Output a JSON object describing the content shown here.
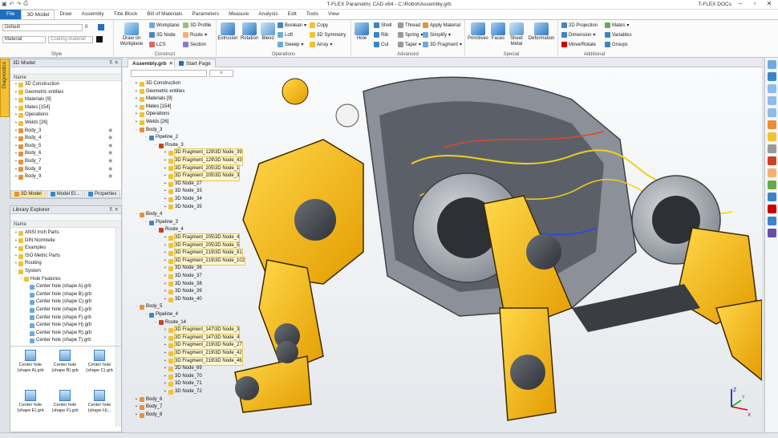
{
  "app": {
    "title": "T-FLEX Parametric CAD x64 - C:\\Robot\\Assembly.grb",
    "docs": "T-FLEX DOCs"
  },
  "tabs": [
    "File",
    "3D Model",
    "Draw",
    "Assembly",
    "Title Block",
    "Bill of Materials",
    "Parameters",
    "Measure",
    "Analysis",
    "Edit",
    "Tools",
    "View"
  ],
  "ribbon": {
    "style": {
      "label": "Style",
      "default_value": "Default",
      "default_count": "0",
      "material_value": "Material",
      "material_placeholder": "Coating material"
    },
    "construct": {
      "label": "Construct",
      "draw_on_workplane": "Draw on Workplane",
      "workplane": "Workplane",
      "node3d": "3D Node",
      "lcs": "LCS",
      "profile3d": "3D Profile",
      "route": "Route",
      "section": "Section"
    },
    "operations": {
      "label": "Operations",
      "extrusion": "Extrusion",
      "rotation": "Rotation",
      "blend": "Blend",
      "boolean": "Boolean",
      "loft": "Loft",
      "sweep": "Sweep",
      "copy": "Copy",
      "symmetry": "3D Symmetry",
      "array": "Array"
    },
    "advanced": {
      "label": "Advanced",
      "hole": "Hole",
      "shell": "Shell",
      "rib": "Rib",
      "cut": "Cut",
      "thread": "Thread",
      "spring": "Spring",
      "taper": "Taper",
      "apply_material": "Apply Material",
      "simplify": "Simplify",
      "fragment3d": "3D Fragment"
    },
    "special": {
      "label": "Special",
      "primitives": "Primitives",
      "faces": "Faces",
      "sheet_metal": "Sheet Metal",
      "deformation": "Deformation"
    },
    "additional": {
      "label": "Additional",
      "projection": "2D Projection",
      "dimension": "Dimension",
      "move_rotate": "Move/Rotate",
      "mates": "Mates",
      "variables": "Variables",
      "groups": "Groups"
    }
  },
  "model_panel": {
    "title": "3D Model",
    "col": "Name",
    "items": [
      {
        "label": "3D Construction",
        "exp": "+"
      },
      {
        "label": "Geometric entities",
        "exp": "+"
      },
      {
        "label": "Materials [9]",
        "exp": "+"
      },
      {
        "label": "Mates [154]",
        "exp": "+"
      },
      {
        "label": "Operations",
        "exp": "+"
      },
      {
        "label": "Welds [26]",
        "exp": "+"
      },
      {
        "label": "Body_3",
        "exp": "+"
      },
      {
        "label": "Body_4",
        "exp": "+"
      },
      {
        "label": "Body_5",
        "exp": "+"
      },
      {
        "label": "Body_6",
        "exp": "+"
      },
      {
        "label": "Body_7",
        "exp": "+"
      },
      {
        "label": "Body_8",
        "exp": "+"
      },
      {
        "label": "Body_9",
        "exp": "+"
      }
    ],
    "tabs": [
      "3D Model",
      "Model El...",
      "Properties"
    ]
  },
  "diagnostics": "Diagnostics",
  "library": {
    "title": "Library Explorer",
    "col": "Name",
    "items": [
      {
        "label": "ANSI Inch Parts",
        "exp": "+",
        "lvl": 0
      },
      {
        "label": "DIN Normteile",
        "exp": "+",
        "lvl": 0
      },
      {
        "label": "Examples",
        "exp": "+",
        "lvl": 0
      },
      {
        "label": "ISO Metric Parts",
        "exp": "+",
        "lvl": 0
      },
      {
        "label": "Routing",
        "exp": "+",
        "lvl": 0
      },
      {
        "label": "System",
        "exp": "-",
        "lvl": 0
      },
      {
        "label": "Hole Features",
        "exp": "-",
        "lvl": 1
      },
      {
        "label": "Center hole (shape A).grb",
        "exp": "",
        "lvl": 2
      },
      {
        "label": "Center hole (shape B).grb",
        "exp": "",
        "lvl": 2
      },
      {
        "label": "Center hole (shape C).grb",
        "exp": "",
        "lvl": 2
      },
      {
        "label": "Center hole (shape E).grb",
        "exp": "",
        "lvl": 2
      },
      {
        "label": "Center hole (shape F).grb",
        "exp": "",
        "lvl": 2
      },
      {
        "label": "Center hole (shape H).grb",
        "exp": "",
        "lvl": 2
      },
      {
        "label": "Center hole (shape R).grb",
        "exp": "",
        "lvl": 2
      },
      {
        "label": "Center hole (shape T).grb",
        "exp": "",
        "lvl": 2
      }
    ],
    "thumbs": [
      "Center hole (shape A).grb",
      "Center hole (shape B).grb",
      "Center hole (shape C).grb",
      "Center hole (shape E).grb",
      "Center hole (shape F).grb",
      "Center hole (shape H)..."
    ]
  },
  "doc_tabs": [
    "Assembly.grb",
    "Start Page"
  ],
  "tree": [
    {
      "label": "3D Construction",
      "lvl": 0,
      "exp": "+"
    },
    {
      "label": "Geometric entities",
      "lvl": 0,
      "exp": "+"
    },
    {
      "label": "Materials [9]",
      "lvl": 0,
      "exp": "+"
    },
    {
      "label": "Mates [154]",
      "lvl": 0,
      "exp": "+"
    },
    {
      "label": "Operations",
      "lvl": 0,
      "exp": "+"
    },
    {
      "label": "Welds [26]",
      "lvl": 0,
      "exp": "+"
    },
    {
      "label": "Body_3",
      "lvl": 0,
      "exp": "-"
    },
    {
      "label": "Pipeline_2",
      "lvl": 1,
      "exp": "-"
    },
    {
      "label": "Route_3",
      "lvl": 2,
      "exp": "-"
    },
    {
      "label": "3D Fragment_129\\3D Node_39",
      "lvl": 3,
      "exp": "+",
      "hl": true
    },
    {
      "label": "3D Fragment_129\\3D Node_43",
      "lvl": 3,
      "exp": "+",
      "hl": true
    },
    {
      "label": "3D Fragment_205\\3D Node_1",
      "lvl": 3,
      "exp": "+",
      "hl": true
    },
    {
      "label": "3D Fragment_205\\3D Node_3",
      "lvl": 3,
      "exp": "+",
      "hl": true
    },
    {
      "label": "3D Node_27",
      "lvl": 3,
      "exp": "+"
    },
    {
      "label": "3D Node_33",
      "lvl": 3,
      "exp": "+"
    },
    {
      "label": "3D Node_34",
      "lvl": 3,
      "exp": "+"
    },
    {
      "label": "3D Node_35",
      "lvl": 3,
      "exp": "+"
    },
    {
      "label": "Body_4",
      "lvl": 0,
      "exp": "-"
    },
    {
      "label": "Pipeline_3",
      "lvl": 1,
      "exp": "-"
    },
    {
      "label": "Route_4",
      "lvl": 2,
      "exp": "-"
    },
    {
      "label": "3D Fragment_205\\3D Node_4",
      "lvl": 3,
      "exp": "+",
      "hl": true
    },
    {
      "label": "3D Fragment_205\\3D Node_5",
      "lvl": 3,
      "exp": "+",
      "hl": true
    },
    {
      "label": "3D Fragment_219\\3D Node_81",
      "lvl": 3,
      "exp": "+",
      "hl": true
    },
    {
      "label": "3D Fragment_219\\3D Node_102",
      "lvl": 3,
      "exp": "+",
      "hl": true
    },
    {
      "label": "3D Node_36",
      "lvl": 3,
      "exp": "+"
    },
    {
      "label": "3D Node_37",
      "lvl": 3,
      "exp": "+"
    },
    {
      "label": "3D Node_38",
      "lvl": 3,
      "exp": "+"
    },
    {
      "label": "3D Node_39",
      "lvl": 3,
      "exp": "+"
    },
    {
      "label": "3D Node_40",
      "lvl": 3,
      "exp": "+"
    },
    {
      "label": "Body_5",
      "lvl": 0,
      "exp": "-"
    },
    {
      "label": "Pipeline_4",
      "lvl": 1,
      "exp": "-"
    },
    {
      "label": "Route_14",
      "lvl": 2,
      "exp": "-"
    },
    {
      "label": "3D Fragment_147\\3D Node_3",
      "lvl": 3,
      "exp": "+",
      "hl": true
    },
    {
      "label": "3D Fragment_147\\3D Node_4",
      "lvl": 3,
      "exp": "+",
      "hl": true
    },
    {
      "label": "3D Fragment_219\\3D Node_27",
      "lvl": 3,
      "exp": "+",
      "hl": true
    },
    {
      "label": "3D Fragment_219\\3D Node_42",
      "lvl": 3,
      "exp": "+",
      "hl": true
    },
    {
      "label": "3D Fragment_219\\3D Node_46",
      "lvl": 3,
      "exp": "+",
      "hl": true
    },
    {
      "label": "3D Node_69",
      "lvl": 3,
      "exp": "+"
    },
    {
      "label": "3D Node_70",
      "lvl": 3,
      "exp": "+"
    },
    {
      "label": "3D Node_71",
      "lvl": 3,
      "exp": "+"
    },
    {
      "label": "3D Node_72",
      "lvl": 3,
      "exp": "+"
    },
    {
      "label": "Body_6",
      "lvl": 0,
      "exp": "+"
    },
    {
      "label": "Body_7",
      "lvl": 0,
      "exp": "+"
    },
    {
      "label": "Body_8",
      "lvl": 0,
      "exp": "+"
    }
  ],
  "axes": {
    "x": "X",
    "y": "Y",
    "z": "Z"
  },
  "colors": {
    "accent": "#1e6fbf",
    "yellow": "#f4b400",
    "gear": "#4a4e54"
  }
}
